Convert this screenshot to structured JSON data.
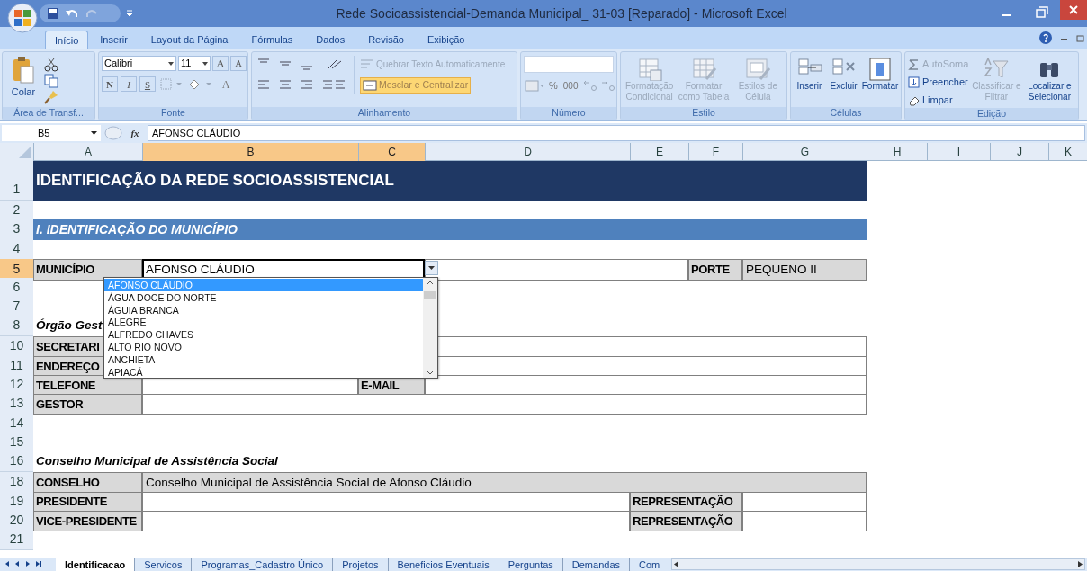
{
  "window": {
    "title": "Rede Socioassistencial-Demanda Municipal_ 31-03 [Reparado] - Microsoft Excel"
  },
  "ribbon": {
    "tabs": [
      {
        "label": "Início",
        "selected": true
      },
      {
        "label": "Inserir",
        "selected": false
      },
      {
        "label": "Layout da Página",
        "selected": false
      },
      {
        "label": "Fórmulas",
        "selected": false
      },
      {
        "label": "Dados",
        "selected": false
      },
      {
        "label": "Revisão",
        "selected": false
      },
      {
        "label": "Exibição",
        "selected": false
      }
    ],
    "clipboard": {
      "paste": "Colar",
      "label": "Área de Transf..."
    },
    "font": {
      "name": "Calibri",
      "size": "11",
      "grow": "A",
      "shrink": "A",
      "bold": "N",
      "italic": "I",
      "underline": "S",
      "font_color_letter": "A",
      "label": "Fonte"
    },
    "alignment": {
      "wrap": {
        "label": "Quebrar Texto Automaticamente",
        "disabled": true
      },
      "merge": {
        "label": "Mesclar e Centralizar",
        "on": true
      },
      "label": "Alinhamento"
    },
    "number": {
      "percent": "%",
      "thousands": "000",
      "label": "Número"
    },
    "styles": {
      "buttons": [
        {
          "label": "Formatação Condicional",
          "disabled": true
        },
        {
          "label": "Formatar como Tabela",
          "disabled": true
        },
        {
          "label": "Estilos de Célula",
          "disabled": true
        }
      ],
      "label": "Estilo"
    },
    "cells": {
      "buttons": [
        {
          "label": "Inserir",
          "disabled": false
        },
        {
          "label": "Excluir",
          "disabled": false
        },
        {
          "label": "Formatar",
          "disabled": false
        }
      ],
      "label": "Células"
    },
    "editing": {
      "small_buttons": [
        {
          "label": "AutoSoma",
          "disabled": true
        },
        {
          "label": "Preencher",
          "disabled": false
        },
        {
          "label": "Limpar",
          "disabled": false
        }
      ],
      "buttons": [
        {
          "label": "Classificar e Filtrar",
          "disabled": true
        },
        {
          "label": "Localizar e Selecionar",
          "disabled": false
        }
      ],
      "label": "Edição"
    }
  },
  "formula_bar": {
    "name_box": "B5",
    "function_label": "fx",
    "value": "AFONSO CLÁUDIO"
  },
  "columns": [
    {
      "label": "A",
      "selected": false
    },
    {
      "label": "B",
      "selected": true
    },
    {
      "label": "C",
      "selected": true
    },
    {
      "label": "D",
      "selected": false
    },
    {
      "label": "E",
      "selected": false
    },
    {
      "label": "F",
      "selected": false
    },
    {
      "label": "G",
      "selected": false
    },
    {
      "label": "H",
      "selected": false
    },
    {
      "label": "I",
      "selected": false
    },
    {
      "label": "J",
      "selected": false
    },
    {
      "label": "K",
      "selected": false
    }
  ],
  "rows": [
    {
      "number": "1",
      "selected": false,
      "kind": "banner",
      "cells": [
        {
          "kind": "title",
          "text": "IDENTIFICAÇÃO DA REDE SOCIOASSISTENCIAL"
        }
      ]
    },
    {
      "number": "2",
      "selected": false,
      "kind": "blank",
      "cells": []
    },
    {
      "number": "3",
      "selected": false,
      "kind": "banner",
      "cells": [
        {
          "kind": "section",
          "text": "I. IDENTIFICAÇÃO DO MUNICÍPIO"
        }
      ]
    },
    {
      "number": "4",
      "selected": false,
      "kind": "blank",
      "cells": []
    },
    {
      "number": "5",
      "selected": true,
      "kind": "porte",
      "cells": [
        {
          "kind": "label",
          "text": "MUNICÍPIO"
        },
        {
          "kind": "active",
          "text": "AFONSO CLÁUDIO"
        },
        {
          "kind": "value"
        },
        {
          "kind": "label",
          "text": "PORTE"
        },
        {
          "kind": "shaded",
          "text": "PEQUENO II"
        }
      ]
    },
    {
      "number": "6",
      "selected": false,
      "kind": "blank",
      "cells": []
    },
    {
      "number": "7",
      "selected": false,
      "kind": "blank",
      "cells": []
    },
    {
      "number": "8",
      "selected": false,
      "kind": "heading",
      "cells": [
        {
          "kind": "heading",
          "text": "Órgão Gest"
        }
      ]
    },
    {
      "number": "10",
      "selected": false,
      "kind": "wide",
      "cells": [
        {
          "kind": "label",
          "text": "SECRETARI"
        },
        {
          "kind": "value"
        }
      ]
    },
    {
      "number": "11",
      "selected": false,
      "kind": "wide",
      "cells": [
        {
          "kind": "label",
          "text": "ENDEREÇO"
        },
        {
          "kind": "value"
        }
      ]
    },
    {
      "number": "12",
      "selected": false,
      "kind": "split",
      "cells": [
        {
          "kind": "label",
          "text": "TELEFONE"
        },
        {
          "kind": "value"
        },
        {
          "kind": "label",
          "text": "E-MAIL"
        },
        {
          "kind": "value"
        }
      ]
    },
    {
      "number": "13",
      "selected": false,
      "kind": "wide",
      "cells": [
        {
          "kind": "label",
          "text": "GESTOR"
        },
        {
          "kind": "value"
        }
      ]
    },
    {
      "number": "14",
      "selected": false,
      "kind": "blank",
      "cells": []
    },
    {
      "number": "15",
      "selected": false,
      "kind": "blank",
      "cells": []
    },
    {
      "number": "16",
      "selected": false,
      "kind": "heading",
      "cells": [
        {
          "kind": "heading",
          "text": "Conselho Municipal de Assistência Social"
        }
      ]
    },
    {
      "number": "18",
      "selected": false,
      "kind": "wide",
      "cells": [
        {
          "kind": "label",
          "text": "CONSELHO"
        },
        {
          "kind": "shaded",
          "text": "Conselho Municipal de Assistência Social de Afonso Cláudio"
        }
      ]
    },
    {
      "number": "19",
      "selected": false,
      "kind": "rep",
      "cells": [
        {
          "kind": "label",
          "text": "PRESIDENTE"
        },
        {
          "kind": "value"
        },
        {
          "kind": "label",
          "text": "REPRESENTAÇÃO"
        },
        {
          "kind": "value"
        }
      ]
    },
    {
      "number": "20",
      "selected": false,
      "kind": "rep",
      "cells": [
        {
          "kind": "label",
          "text": "VICE-PRESIDENTE"
        },
        {
          "kind": "value"
        },
        {
          "kind": "label",
          "text": "REPRESENTAÇÃO"
        },
        {
          "kind": "value"
        }
      ]
    },
    {
      "number": "21",
      "selected": false,
      "kind": "blank",
      "cells": []
    }
  ],
  "dropdown": {
    "items": [
      {
        "label": "AFONSO CLÁUDIO",
        "selected": true
      },
      {
        "label": "ÁGUA DOCE DO NORTE",
        "selected": false
      },
      {
        "label": "ÁGUIA BRANCA",
        "selected": false
      },
      {
        "label": "ALEGRE",
        "selected": false
      },
      {
        "label": "ALFREDO CHAVES",
        "selected": false
      },
      {
        "label": "ALTO RIO NOVO",
        "selected": false
      },
      {
        "label": "ANCHIETA",
        "selected": false
      },
      {
        "label": "APIACÁ",
        "selected": false
      }
    ]
  },
  "sheet_tabs": [
    {
      "label": "Identificacao",
      "selected": true
    },
    {
      "label": "Servicos",
      "selected": false
    },
    {
      "label": "Programas_Cadastro Único",
      "selected": false
    },
    {
      "label": "Projetos",
      "selected": false
    },
    {
      "label": "Beneficios Eventuais",
      "selected": false
    },
    {
      "label": "Perguntas",
      "selected": false
    },
    {
      "label": "Demandas",
      "selected": false
    },
    {
      "label": "Com",
      "selected": false
    }
  ]
}
